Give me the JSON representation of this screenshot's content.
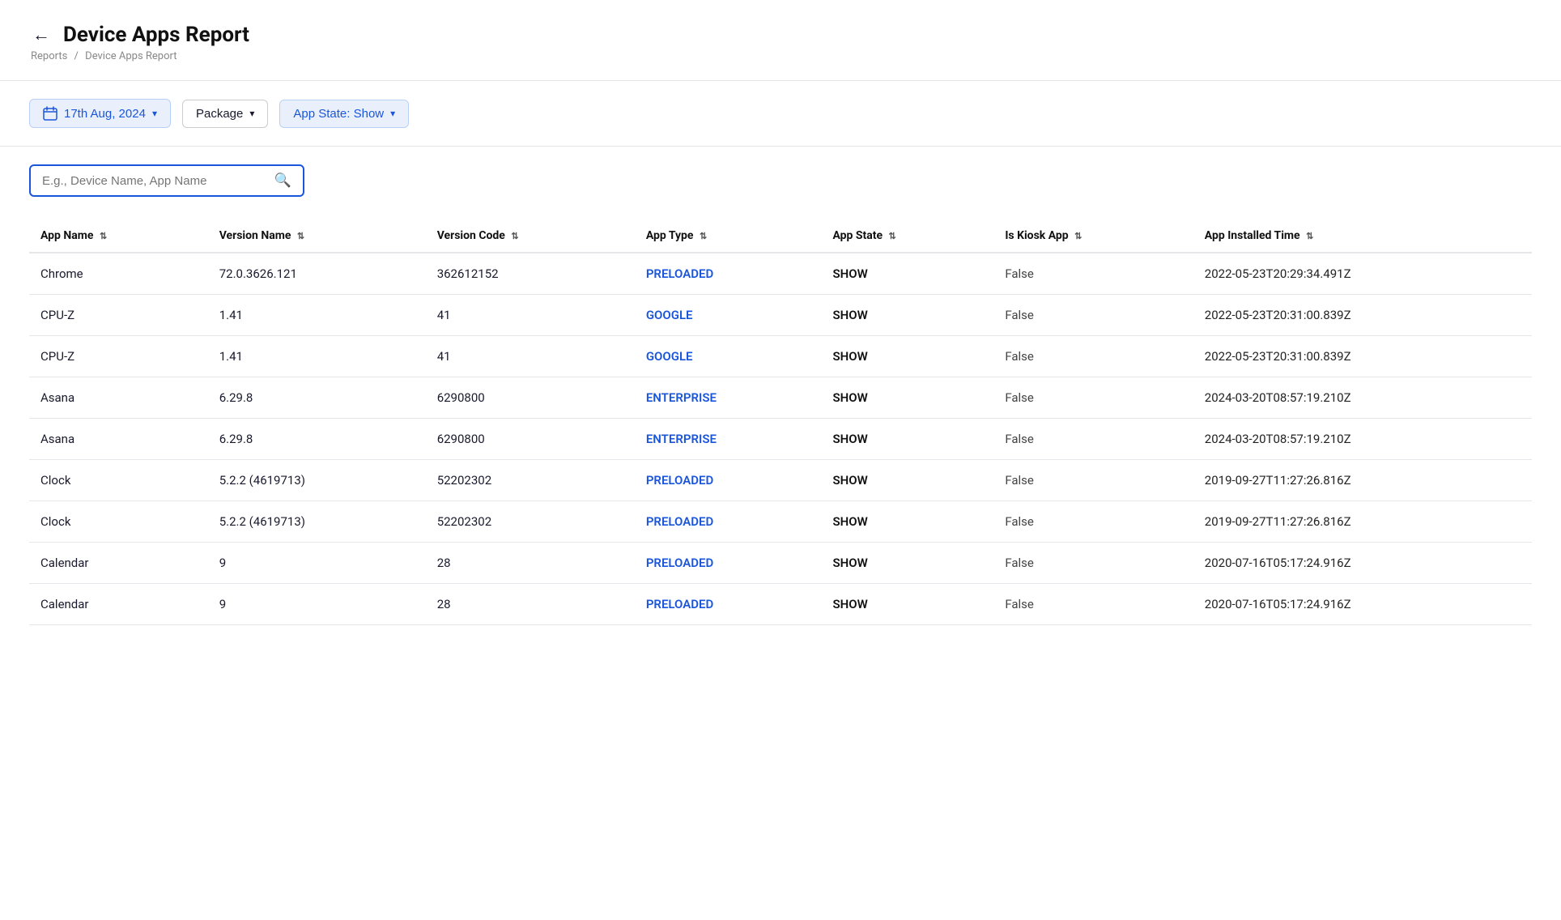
{
  "header": {
    "back_label": "←",
    "title": "Device Apps Report"
  },
  "breadcrumb": {
    "parent": "Reports",
    "separator": "/",
    "current": "Device Apps Report"
  },
  "filters": {
    "date_label": "17th Aug, 2024",
    "package_label": "Package",
    "app_state_label": "App State: Show"
  },
  "search": {
    "placeholder": "E.g., Device Name, App Name"
  },
  "table": {
    "columns": [
      {
        "key": "app_name",
        "label": "App Name"
      },
      {
        "key": "version_name",
        "label": "Version Name"
      },
      {
        "key": "version_code",
        "label": "Version Code"
      },
      {
        "key": "app_type",
        "label": "App Type"
      },
      {
        "key": "app_state",
        "label": "App State"
      },
      {
        "key": "is_kiosk_app",
        "label": "Is Kiosk App"
      },
      {
        "key": "app_installed_time",
        "label": "App Installed Time"
      }
    ],
    "rows": [
      {
        "app_name": "Chrome",
        "version_name": "72.0.3626.121",
        "version_code": "362612152",
        "app_type": "PRELOADED",
        "app_state": "SHOW",
        "is_kiosk_app": "False",
        "app_installed_time": "2022-05-23T20:29:34.491Z"
      },
      {
        "app_name": "CPU-Z",
        "version_name": "1.41",
        "version_code": "41",
        "app_type": "GOOGLE",
        "app_state": "SHOW",
        "is_kiosk_app": "False",
        "app_installed_time": "2022-05-23T20:31:00.839Z"
      },
      {
        "app_name": "CPU-Z",
        "version_name": "1.41",
        "version_code": "41",
        "app_type": "GOOGLE",
        "app_state": "SHOW",
        "is_kiosk_app": "False",
        "app_installed_time": "2022-05-23T20:31:00.839Z"
      },
      {
        "app_name": "Asana",
        "version_name": "6.29.8",
        "version_code": "6290800",
        "app_type": "ENTERPRISE",
        "app_state": "SHOW",
        "is_kiosk_app": "False",
        "app_installed_time": "2024-03-20T08:57:19.210Z"
      },
      {
        "app_name": "Asana",
        "version_name": "6.29.8",
        "version_code": "6290800",
        "app_type": "ENTERPRISE",
        "app_state": "SHOW",
        "is_kiosk_app": "False",
        "app_installed_time": "2024-03-20T08:57:19.210Z"
      },
      {
        "app_name": "Clock",
        "version_name": "5.2.2 (4619713)",
        "version_code": "52202302",
        "app_type": "PRELOADED",
        "app_state": "SHOW",
        "is_kiosk_app": "False",
        "app_installed_time": "2019-09-27T11:27:26.816Z"
      },
      {
        "app_name": "Clock",
        "version_name": "5.2.2 (4619713)",
        "version_code": "52202302",
        "app_type": "PRELOADED",
        "app_state": "SHOW",
        "is_kiosk_app": "False",
        "app_installed_time": "2019-09-27T11:27:26.816Z"
      },
      {
        "app_name": "Calendar",
        "version_name": "9",
        "version_code": "28",
        "app_type": "PRELOADED",
        "app_state": "SHOW",
        "is_kiosk_app": "False",
        "app_installed_time": "2020-07-16T05:17:24.916Z"
      },
      {
        "app_name": "Calendar",
        "version_name": "9",
        "version_code": "28",
        "app_type": "PRELOADED",
        "app_state": "SHOW",
        "is_kiosk_app": "False",
        "app_installed_time": "2020-07-16T05:17:24.916Z"
      }
    ]
  }
}
